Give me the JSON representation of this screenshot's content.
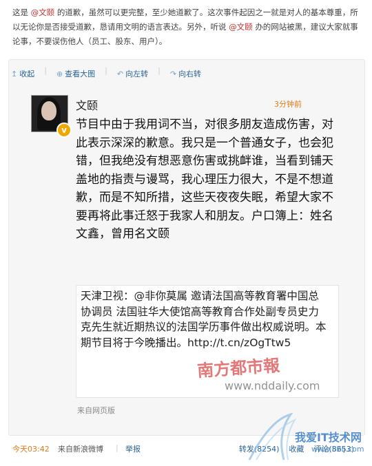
{
  "intro": {
    "p1": "这是",
    "mention1": "@文颐",
    "p2": "的道歉，虽然可以更完整，至少她道歉了。这次事件起因之一就是对人的基本尊重，所以无论你是否接受道歉，恳请用文明的语言表达。另外，听说",
    "mention2": "@文颐",
    "p3": "办的网站被黑，建议大家就事论事，不要误伤他人（员工、股东、用户）。"
  },
  "toolbar": {
    "collapse": "收起",
    "view_large": "查看大图",
    "rotate_left": "向左转",
    "rotate_right": "向右转"
  },
  "post": {
    "author": "文颐",
    "time": "3分钟前",
    "text": "节目中由于我用词不当，对很多朋友造成伤害，对此表示深深的歉意。我只是一个普通女子，也会犯错，但我绝没有想恶意伤害或挑衅谁，当看到铺天盖地的指责与谩骂，我心理压力很大，不是不想道歉，而是不知所措，这些天夜夜失眠，希望大家不要再将此事迁怒于我家人和朋友。户口簿上：姓名文鑫，曾用名文颐",
    "quote": "天津卫视：@非你莫属 邀请法国高等教育署中国总协调员 法国驻华大使馆高等教育合作处副专员史力克先生就近期热议的法国学历事件做出权威说明。本期节目将于今晚播出。http://t.cn/zOgTtw5",
    "watermark_cn": "南方都市報",
    "watermark_url": "www.nddaily.com",
    "source": "来自网页版"
  },
  "footer": {
    "time": "今天03:42",
    "from": "来自新浪微博",
    "report": "举报",
    "repost": "转发(8254)",
    "favorite": "收藏",
    "comment": "评论(8653)"
  },
  "site_watermark": {
    "text": "我爱IT技术网",
    "url": "www.52ij.com"
  },
  "colors": {
    "accent_link": "#2a6496",
    "time_orange": "#e07b1a",
    "mention_red": "#c03030",
    "verified_badge": "#f0a800"
  }
}
